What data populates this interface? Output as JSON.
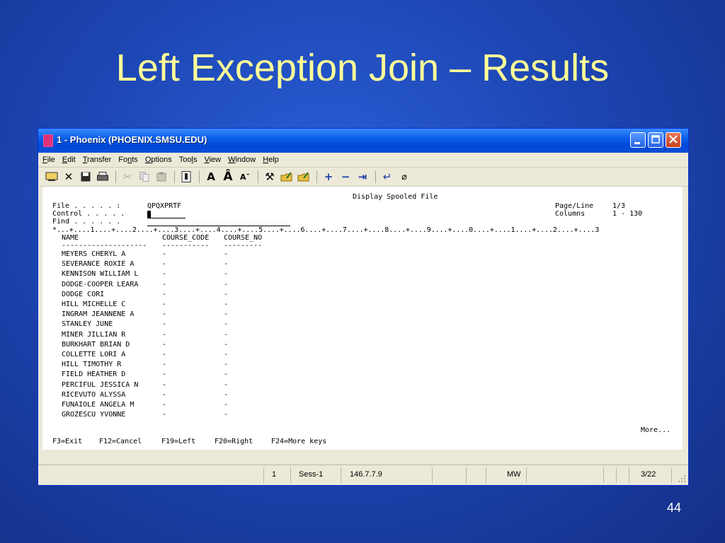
{
  "slide": {
    "title": "Left Exception Join – Results",
    "number": "44"
  },
  "window": {
    "title": "1 - Phoenix (PHOENIX.SMSU.EDU)"
  },
  "menu": [
    "File",
    "Edit",
    "Transfer",
    "Fonts",
    "Options",
    "Tools",
    "View",
    "Window",
    "Help"
  ],
  "toolbar_icons": [
    "disconnect-icon",
    "cancel-icon",
    "save-icon",
    "print-icon",
    "cut-icon",
    "copy-icon",
    "paste-icon",
    "keyboard-icon",
    "font-bold-icon",
    "font-larger-icon",
    "font-smaller-icon",
    "tools-icon",
    "send-icon",
    "receive-icon",
    "plus-icon",
    "minus-icon",
    "tab-icon",
    "enter-icon",
    "eraser-icon"
  ],
  "screen": {
    "heading": "Display Spooled File",
    "file_label": "File . . . . . :",
    "file_value": "QPQXPRTF",
    "control_label": "Control . . . . .",
    "find_label": "Find . . . . . .",
    "page_line_label": "Page/Line",
    "page_line_value": "1/3",
    "columns_label": "Columns",
    "columns_value": "1 - 130",
    "ruler": "*...+....1....+....2....+....3....+....4....+....5....+....6....+....7....+....8....+....9....+....0....+....1....+....2....+....3",
    "headers": [
      "NAME",
      "COURSE_CODE",
      "COURSE_NO"
    ],
    "dashes": [
      "--------------------",
      "-----------",
      "---------"
    ],
    "rows": [
      [
        "MEYERS CHERYL A",
        "-",
        "-"
      ],
      [
        "SEVERANCE ROXIE A",
        "-",
        "-"
      ],
      [
        "KENNISON WILLIAM L",
        "-",
        "-"
      ],
      [
        "DODGE-COOPER LEARA",
        "-",
        "-"
      ],
      [
        "DODGE CORI",
        "-",
        "-"
      ],
      [
        "HILL MICHELLE C",
        "-",
        "-"
      ],
      [
        "INGRAM JEANNENE A",
        "-",
        "-"
      ],
      [
        "STANLEY JUNE",
        "-",
        "-"
      ],
      [
        "MINER JILLIAN R",
        "-",
        "-"
      ],
      [
        "BURKHART BRIAN D",
        "-",
        "-"
      ],
      [
        "COLLETTE LORI A",
        "-",
        "-"
      ],
      [
        "HILL TIMOTHY R",
        "-",
        "-"
      ],
      [
        "FIELD HEATHER D",
        "-",
        "-"
      ],
      [
        "PERCIFUL JESSICA N",
        "-",
        "-"
      ],
      [
        "RICEVUTO ALYSSA",
        "-",
        "-"
      ],
      [
        "FUNAIOLE ANGELA M",
        "-",
        "-"
      ],
      [
        "GROZESCU YVONNE",
        "-",
        "-"
      ]
    ],
    "more": "More...",
    "fkeys": [
      "F3=Exit",
      "F12=Cancel",
      "F19=Left",
      "F20=Right",
      "F24=More keys"
    ]
  },
  "status": {
    "field1": "1",
    "session": "Sess-1",
    "address": "146.7.7.9",
    "mode": "MW",
    "cursor": "3/22"
  }
}
